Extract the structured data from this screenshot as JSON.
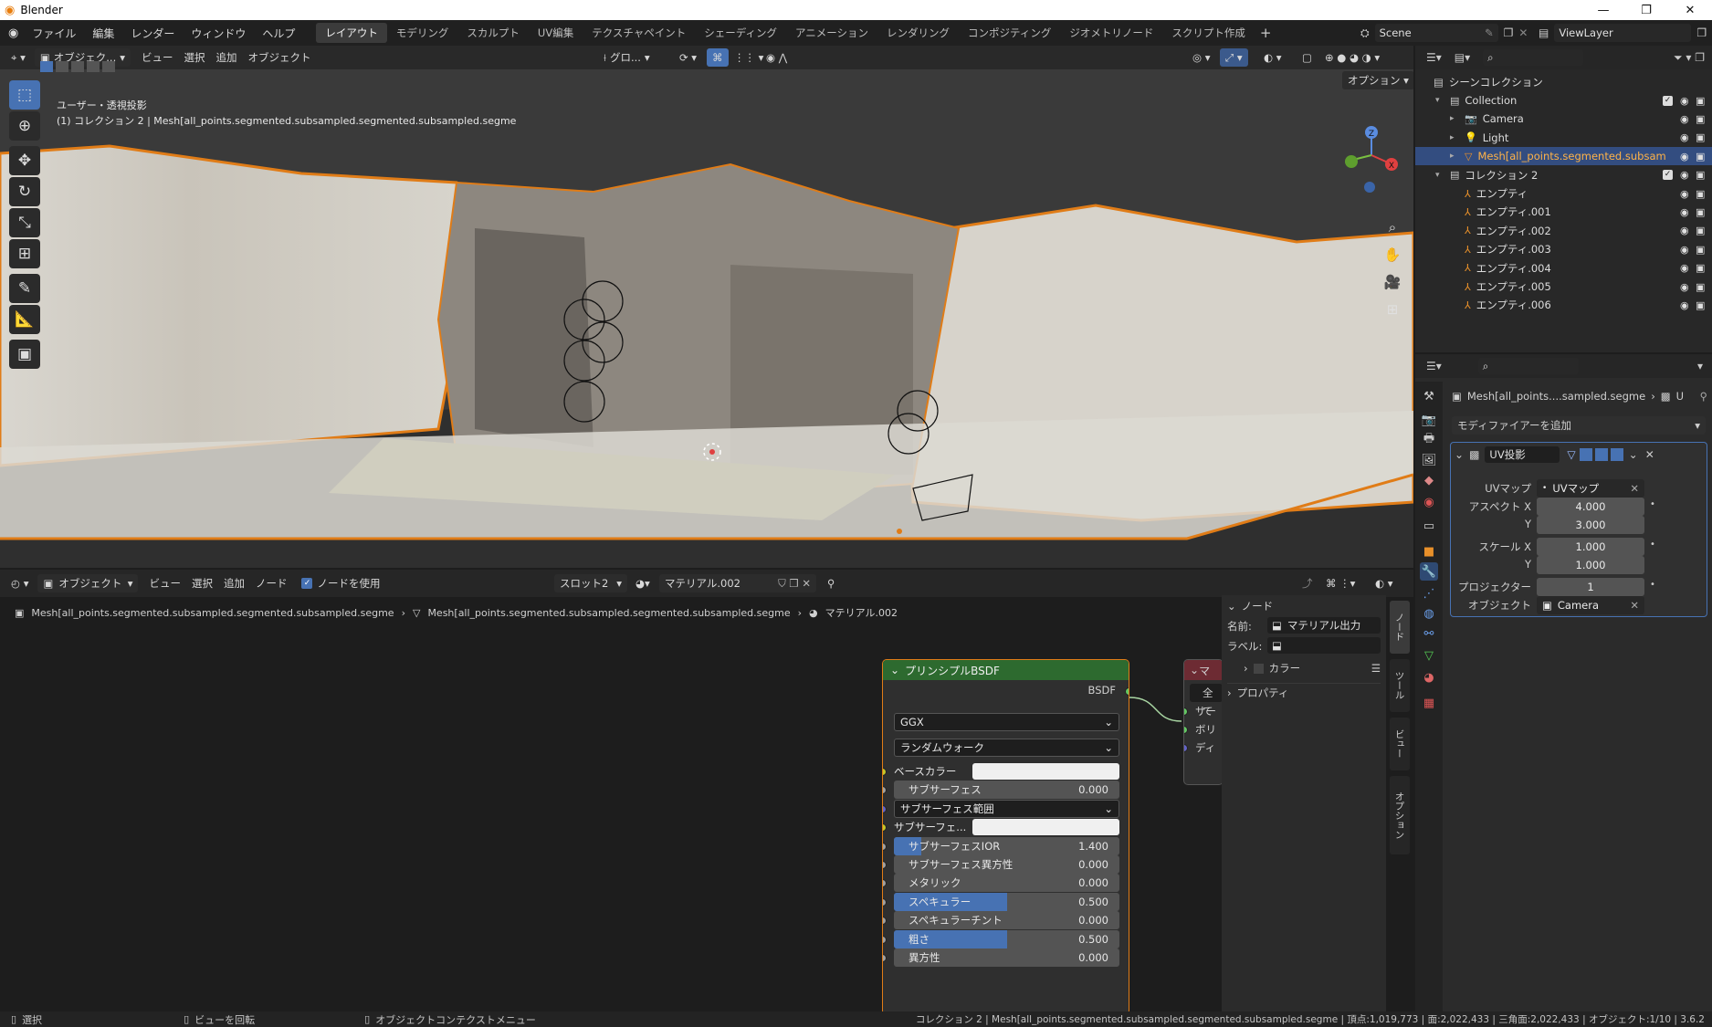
{
  "window": {
    "title": "Blender"
  },
  "menubar": {
    "menus": [
      "ファイル",
      "編集",
      "レンダー",
      "ウィンドウ",
      "ヘルプ"
    ],
    "workspaces": [
      "レイアウト",
      "モデリング",
      "スカルプト",
      "UV編集",
      "テクスチャペイント",
      "シェーディング",
      "アニメーション",
      "レンダリング",
      "コンポジティング",
      "ジオメトリノード",
      "スクリプト作成"
    ],
    "active_workspace": "レイアウト",
    "scene": "Scene",
    "view_layer": "ViewLayer"
  },
  "viewport": {
    "mode": "オブジェク...",
    "menu": [
      "ビュー",
      "選択",
      "追加",
      "オブジェクト"
    ],
    "transform_orientation": "グロ...",
    "options_label": "オプション",
    "view_label": "ユーザー・透視投影",
    "context_label": "(1) コレクション 2 | Mesh[all_points.segmented.subsampled.segmented.subsampled.segme"
  },
  "outliner": {
    "root": "シーンコレクション",
    "items": [
      {
        "name": "Collection",
        "level": 1,
        "selected": false
      },
      {
        "name": "Camera",
        "level": 2,
        "selected": false
      },
      {
        "name": "Light",
        "level": 2,
        "selected": false
      },
      {
        "name": "Mesh[all_points.segmented.subsam",
        "level": 2,
        "selected": true
      },
      {
        "name": "コレクション 2",
        "level": 1,
        "selected": false
      },
      {
        "name": "エンプティ",
        "level": 2,
        "selected": false
      },
      {
        "name": "エンプティ.001",
        "level": 2,
        "selected": false
      },
      {
        "name": "エンプティ.002",
        "level": 2,
        "selected": false
      },
      {
        "name": "エンプティ.003",
        "level": 2,
        "selected": false
      },
      {
        "name": "エンプティ.004",
        "level": 2,
        "selected": false
      },
      {
        "name": "エンプティ.005",
        "level": 2,
        "selected": false
      },
      {
        "name": "エンプティ.006",
        "level": 2,
        "selected": false
      }
    ]
  },
  "properties": {
    "breadcrumb_object": "Mesh[all_points....sampled.segme",
    "breadcrumb_tail": "U",
    "add_modifier": "モディファイアーを追加",
    "modifier_name": "UV投影",
    "uvmap_label": "UVマップ",
    "uvmap_value": "UVマップ",
    "aspect_x_label": "アスペクト X",
    "aspect_x": "4.000",
    "aspect_y_label": "Y",
    "aspect_y": "3.000",
    "scale_x_label": "スケール X",
    "scale_x": "1.000",
    "scale_y_label": "Y",
    "scale_y": "1.000",
    "projectors_label": "プロジェクター",
    "projectors": "1",
    "object_label": "オブジェクト",
    "object_value": "Camera"
  },
  "node_editor": {
    "mode": "オブジェクト",
    "menu": [
      "ビュー",
      "選択",
      "追加",
      "ノード"
    ],
    "use_nodes_label": "ノードを使用",
    "use_nodes": true,
    "slot": "スロット2",
    "material": "マテリアル.002",
    "breadcrumb": [
      "Mesh[all_points.segmented.subsampled.segmented.subsampled.segme",
      "Mesh[all_points.segmented.subsampled.segmented.subsampled.segme",
      "マテリアル.002"
    ],
    "bsdf": {
      "title": "プリンシプルBSDF",
      "output": "BSDF",
      "distribution": "GGX",
      "subsurface_method": "ランダムウォーク",
      "rows": [
        {
          "label": "ベースカラー",
          "type": "color",
          "socket": "#c7c729"
        },
        {
          "label": "サブサーフェス",
          "type": "num",
          "value": "0.000",
          "fill": 0,
          "socket": "#a1a1a1"
        },
        {
          "label": "サブサーフェス範囲",
          "type": "select",
          "socket": "#6363c7"
        },
        {
          "label": "サブサーフェ...",
          "type": "color",
          "socket": "#c7c729"
        },
        {
          "label": "サブサーフェスIOR",
          "type": "num",
          "value": "1.400",
          "fill": 0.12,
          "socket": "#a1a1a1"
        },
        {
          "label": "サブサーフェス異方性",
          "type": "num",
          "value": "0.000",
          "fill": 0,
          "socket": "#a1a1a1"
        },
        {
          "label": "メタリック",
          "type": "num",
          "value": "0.000",
          "fill": 0,
          "socket": "#a1a1a1"
        },
        {
          "label": "スペキュラー",
          "type": "num",
          "value": "0.500",
          "fill": 0.5,
          "socket": "#a1a1a1"
        },
        {
          "label": "スペキュラーチント",
          "type": "num",
          "value": "0.000",
          "fill": 0,
          "socket": "#a1a1a1"
        },
        {
          "label": "粗さ",
          "type": "num",
          "value": "0.500",
          "fill": 0.5,
          "socket": "#a1a1a1"
        },
        {
          "label": "異方性",
          "type": "num",
          "value": "0.000",
          "fill": 0,
          "socket": "#a1a1a1"
        }
      ]
    },
    "output_node": {
      "title_fragment": "マ",
      "target": "全て",
      "inputs": [
        "サー",
        "ボリ",
        "ディ"
      ]
    },
    "npanel": {
      "section": "ノード",
      "name_label": "名前:",
      "name_value": "マテリアル出力",
      "label_label": "ラベル:",
      "label_value": "",
      "color_label": "カラー",
      "props_label": "プロパティ",
      "side_tabs": [
        "ノード",
        "ツール",
        "ビュー",
        "オプション"
      ]
    }
  },
  "statusbar": {
    "left_select": "選択",
    "left_rotate": "ビューを回転",
    "left_context": "オブジェクトコンテクストメニュー",
    "stats": "コレクション 2 | Mesh[all_points.segmented.subsampled.segmented.subsampled.segme | 頂点:1,019,773 | 面:2,022,433 | 三角面:2,022,433 | オブジェクト:1/10 | 3.6.2"
  },
  "colors": {
    "accent": "#4772b3",
    "selected_outline": "#e07c17",
    "node_header": "#2d6a2f"
  }
}
